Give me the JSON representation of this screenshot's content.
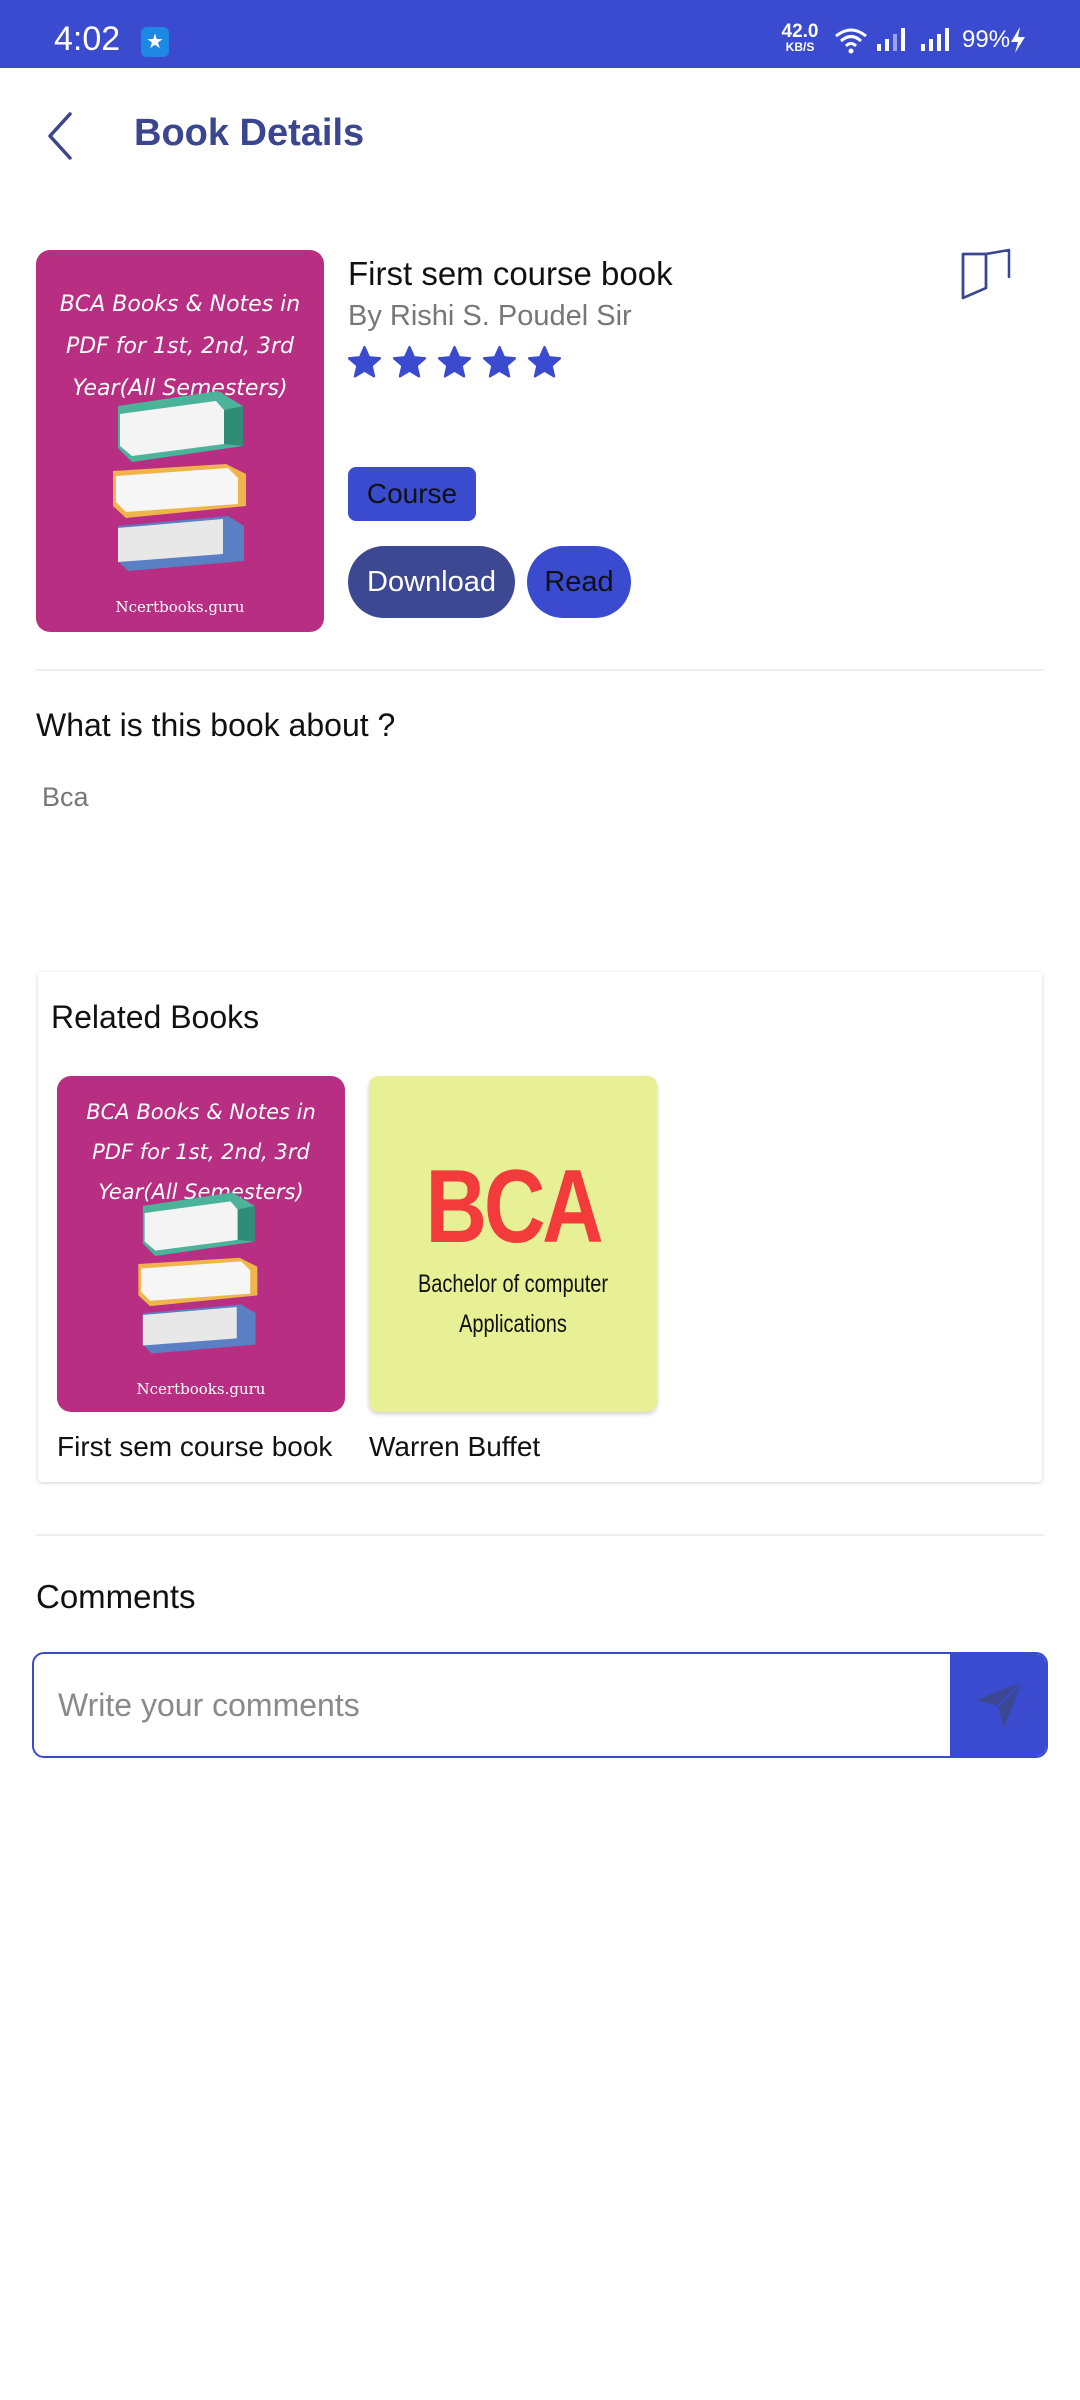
{
  "status_bar": {
    "time": "4:02",
    "usb_icon": "usb-icon",
    "net_speed_value": "42.0",
    "net_speed_unit": "KB/S",
    "battery": "99%"
  },
  "header": {
    "title": "Book Details",
    "back_icon": "back-arrow-icon"
  },
  "book": {
    "title": "First sem course book",
    "author": "By Rishi S. Poudel Sir",
    "rating": 5,
    "rating_max": 5,
    "tag": "Course",
    "download_label": "Download",
    "read_label": "Read",
    "cover": {
      "heading": "BCA Books & Notes in PDF for 1st, 2nd, 3rd Year(All Semesters)",
      "footer": "Ncertbooks.guru"
    }
  },
  "about": {
    "title": "What is this book about ?",
    "text": "Bca"
  },
  "related": {
    "title": "Related Books",
    "items": [
      {
        "label": "First sem course book",
        "cover_heading": "BCA Books & Notes in PDF for 1st, 2nd, 3rd Year(All Semesters)",
        "cover_footer": "Ncertbooks.guru"
      },
      {
        "label": "Warren Buffet",
        "cover_big": "BCA",
        "cover_sub_1": "Bachelor of computer",
        "cover_sub_2": "Applications"
      }
    ]
  },
  "comments": {
    "title": "Comments",
    "placeholder": "Write your comments",
    "send_icon": "send-icon"
  },
  "colors": {
    "accent": "#3a4bcf",
    "primary_dark": "#3d4893",
    "title_blue": "#3a4690",
    "cover_magenta": "#b72e82",
    "bca_yellow": "#e8f096",
    "bca_red": "#f43b3b"
  }
}
